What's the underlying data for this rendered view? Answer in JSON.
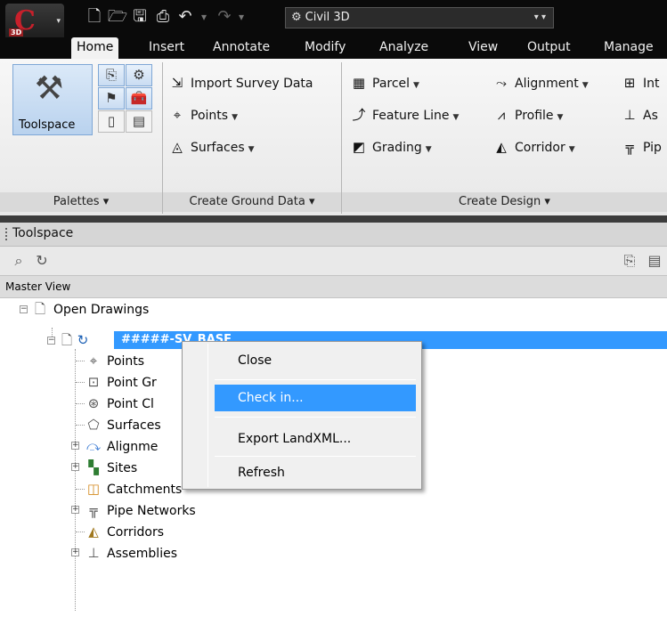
{
  "quick_access": {
    "app_badge": "3D",
    "workspace": "Civil 3D"
  },
  "tabs": [
    "Home",
    "Insert",
    "Annotate",
    "Modify",
    "Analyze",
    "View",
    "Output",
    "Manage"
  ],
  "ribbon": {
    "palettes": {
      "big_button": "Toolspace",
      "title": "Palettes"
    },
    "ground_data": {
      "items": [
        "Import Survey Data",
        "Points",
        "Surfaces"
      ],
      "title": "Create Ground Data"
    },
    "design": {
      "col1": [
        "Parcel",
        "Feature Line",
        "Grading"
      ],
      "col2": [
        "Alignment",
        "Profile",
        "Corridor"
      ],
      "col3": [
        "Int",
        "As",
        "Pip"
      ],
      "title": "Create Design"
    }
  },
  "toolspace": {
    "title": "Toolspace",
    "view": "Master View"
  },
  "tree": {
    "root": "Open Drawings",
    "drawing": "#####-SV_BASE",
    "children": [
      "Points",
      "Point Gr",
      "Point Cl",
      "Surfaces",
      "Alignme",
      "Sites",
      "Catchments",
      "Pipe Networks",
      "Corridors",
      "Assemblies"
    ]
  },
  "context_menu": {
    "items": [
      "Close",
      "Check in...",
      "Export LandXML...",
      "Refresh"
    ],
    "highlighted": "Check in..."
  },
  "colors": {
    "selection": "#3399ff",
    "titlebar": "#0a0a0a",
    "ribbon_active": "#c9dcf2"
  }
}
